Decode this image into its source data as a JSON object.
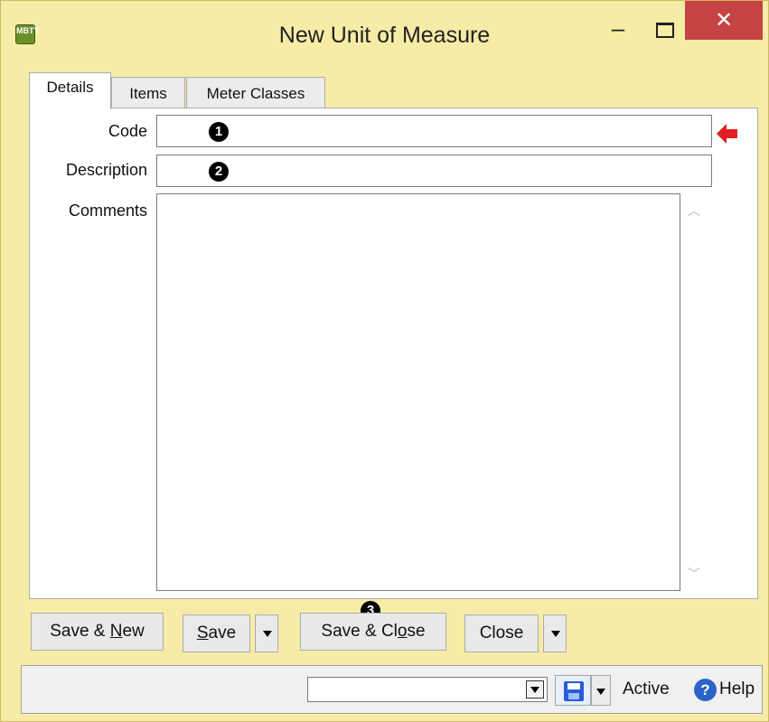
{
  "window": {
    "title": "New Unit of Measure",
    "app_icon_text": "MBTY",
    "minimize_glyph": "–",
    "close_glyph": "✕"
  },
  "tabs": [
    {
      "label": "Details",
      "active": true
    },
    {
      "label": "Items",
      "active": false
    },
    {
      "label": "Meter Classes",
      "active": false
    }
  ],
  "form": {
    "code_label": "Code",
    "code_value": "",
    "description_label": "Description",
    "description_value": "",
    "comments_label": "Comments",
    "comments_value": ""
  },
  "markers": [
    "1",
    "2",
    "3"
  ],
  "buttons": {
    "save_new_pre": "Save & ",
    "save_new_u": "N",
    "save_new_post": "ew",
    "save_u": "S",
    "save_post": "ave",
    "save_close_pre": "Save & Cl",
    "save_close_u": "o",
    "save_close_post": "se",
    "close": "Close"
  },
  "statusbar": {
    "combo_value": "",
    "active_label": "Active",
    "help_label": "Help",
    "help_glyph": "?"
  },
  "colors": {
    "window_bg": "#f6eca6",
    "close_button": "#c74343",
    "required_arrow": "#e02020",
    "help_icon": "#2b63c9"
  }
}
